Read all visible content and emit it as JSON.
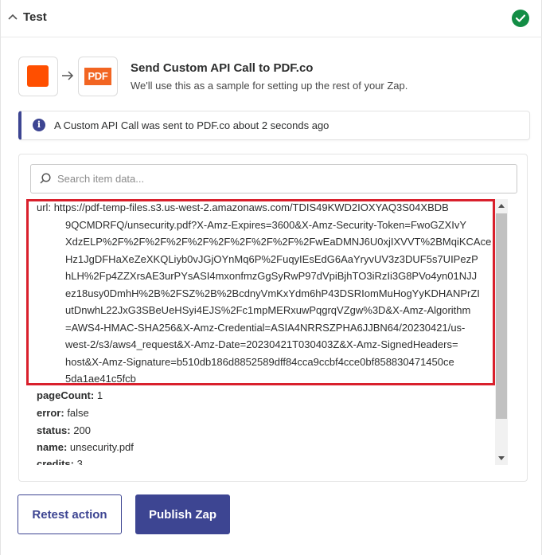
{
  "header": {
    "title": "Test",
    "status_icon": "check-circle-icon",
    "status_color": "#138d45"
  },
  "step": {
    "source_app_icon": "zapier-app-icon",
    "source_app_color": "#ff4f00",
    "target_app_logo": "PDF",
    "target_app_color": "#f26522",
    "title": "Send Custom API Call to PDF.co",
    "subtitle": "We'll use this as a sample for setting up the rest of your Zap."
  },
  "alert": {
    "icon": "info-icon",
    "text": "A Custom API Call was sent to PDF.co about 2 seconds ago",
    "accent": "#3d4592"
  },
  "search": {
    "placeholder": "Search item data...",
    "value": ""
  },
  "data": {
    "url_key": "url:",
    "url_lines": [
      "https://pdf-temp-files.s3.us-west-2.amazonaws.com/TDIS49KWD2IOXYAQ3S04XBDB",
      "9QCMDRFQ/unsecurity.pdf?X-Amz-Expires=3600&X-Amz-Security-Token=FwoGZXIvY",
      "XdzELP%2F%2F%2F%2F%2F%2F%2F%2F%2F%2FwEaDMNJ6U0xjIXVVT%2BMqiKCAce",
      "Hz1JgDFHaXeZeXKQLiyb0vJGjOYnMq6P%2FuqyIEsEdG6AaYryvUV3z3DUF5s7UIPezP",
      "hLH%2Fp4ZZXrsAE3urPYsASI4mxonfmzGgSyRwP97dVpiBjhTO3iRzIi3G8PVo4yn01NJJ",
      "ez18usy0DmhH%2B%2FSZ%2B%2BcdnyVmKxYdm6hP43DSRIomMuHogYyKDHANPrZI",
      "utDnwhL22JxG3SBeUeHSyi4EJS%2Fc1mpMERxuwPqgrqVZgw%3D&X-Amz-Algorithm",
      "=AWS4-HMAC-SHA256&X-Amz-Credential=ASIA4NRRSZPHA6JJBN64/20230421/us-",
      "west-2/s3/aws4_request&X-Amz-Date=20230421T030403Z&X-Amz-SignedHeaders=",
      "host&X-Amz-Signature=b510db186d8852589dff84cca9ccbf4cce0bf858830471450ce",
      "5da1ae41c5fcb"
    ],
    "fields": [
      {
        "key": "pageCount:",
        "value": "1"
      },
      {
        "key": "error:",
        "value": "false"
      },
      {
        "key": "status:",
        "value": "200"
      },
      {
        "key": "name:",
        "value": "unsecurity.pdf"
      },
      {
        "key": "credits:",
        "value": "3"
      }
    ],
    "highlight_color": "#d9202c"
  },
  "actions": {
    "retest_label": "Retest action",
    "publish_label": "Publish Zap",
    "primary_color": "#3d4592"
  }
}
